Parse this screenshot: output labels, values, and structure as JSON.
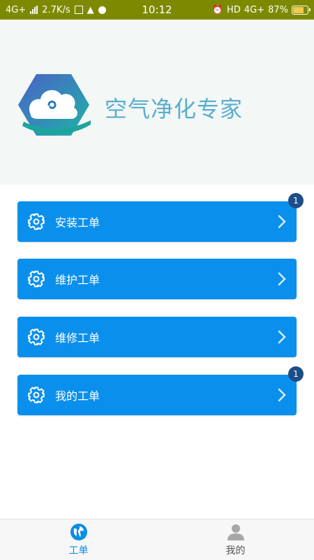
{
  "status_bar": {
    "network": "4G+",
    "speed": "2.7K/s",
    "time": "10:12",
    "hd": "HD",
    "network_right": "4G+",
    "battery": "87%"
  },
  "header": {
    "app_title": "空气净化专家"
  },
  "menu": [
    {
      "label": "安装工单",
      "badge": "1"
    },
    {
      "label": "维护工单",
      "badge": ""
    },
    {
      "label": "维修工单",
      "badge": ""
    },
    {
      "label": "我的工单",
      "badge": "1"
    }
  ],
  "bottom_nav": [
    {
      "label": "工单",
      "icon": "globe-icon",
      "active": true
    },
    {
      "label": "我的",
      "icon": "user-icon",
      "active": false
    }
  ],
  "colors": {
    "accent": "#0a90ec",
    "badge": "#1e4e86",
    "status_bar": "#7d8a00",
    "title": "#5aaed0"
  }
}
